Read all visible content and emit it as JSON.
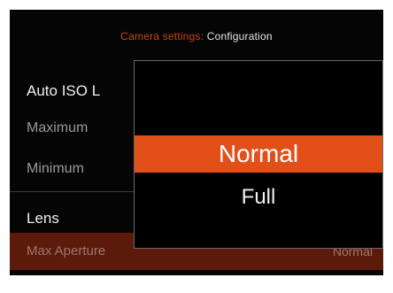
{
  "header": {
    "parent": "Camera settings",
    "separator": ":",
    "current": "Configuration"
  },
  "menu": {
    "auto_iso": "Auto ISO L",
    "maximum": "Maximum",
    "minimum": "Minimum",
    "lens": "Lens",
    "max_aperture": "Max Aperture",
    "max_aperture_value": "Normal"
  },
  "popup": {
    "options": [
      "Normal",
      "Full"
    ],
    "selected": "Normal"
  },
  "colors": {
    "accent": "#e2501a",
    "accent_dim": "#5b1a0a",
    "background": "#050505"
  }
}
